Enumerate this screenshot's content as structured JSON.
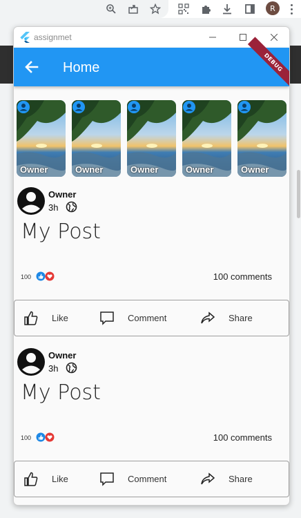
{
  "browser": {
    "toolbar_icons": [
      "zoom-icon",
      "share-icon",
      "star-icon",
      "qr-code-icon",
      "extensions-icon",
      "download-icon",
      "sidebar-icon"
    ],
    "profile_initial": "R"
  },
  "window": {
    "title": "assignmet",
    "controls": [
      "minimize",
      "maximize",
      "close"
    ]
  },
  "appbar": {
    "title": "Home",
    "debug_banner": "DEBUG",
    "color": "#2196f3"
  },
  "stories": [
    {
      "name": "Owner"
    },
    {
      "name": "Owner"
    },
    {
      "name": "Owner"
    },
    {
      "name": "Owner"
    },
    {
      "name": "Owner"
    }
  ],
  "posts": [
    {
      "owner": "Owner",
      "time": "3h",
      "text": "My Post",
      "reaction_count": "100",
      "comments": "100 comments",
      "actions": {
        "like": "Like",
        "comment": "Comment",
        "share": "Share"
      }
    },
    {
      "owner": "Owner",
      "time": "3h",
      "text": "My Post",
      "reaction_count": "100",
      "comments": "100 comments",
      "actions": {
        "like": "Like",
        "comment": "Comment",
        "share": "Share"
      }
    }
  ]
}
